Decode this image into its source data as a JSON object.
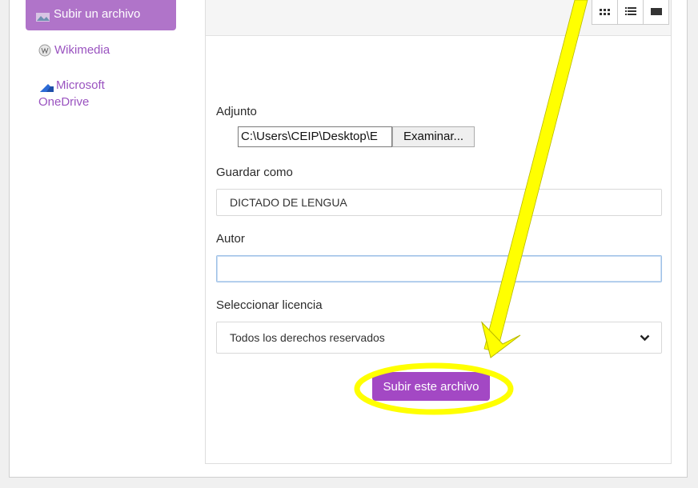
{
  "sidebar": {
    "upload_label": "Subir un archivo",
    "wikimedia_label": "Wikimedia",
    "onedrive_label": "Microsoft OneDrive"
  },
  "form": {
    "attachment_label": "Adjunto",
    "file_path": "C:\\Users\\CEIP\\Desktop\\E",
    "browse_button": "Examinar...",
    "save_as_label": "Guardar como",
    "save_as_value": "DICTADO DE LENGUA",
    "author_label": "Autor",
    "author_value": "",
    "license_label": "Seleccionar licencia",
    "license_value": "Todos los derechos reservados",
    "submit_button": "Subir este archivo"
  },
  "colors": {
    "accent_purple": "#a348c4",
    "annotation_yellow": "#ffff00"
  }
}
